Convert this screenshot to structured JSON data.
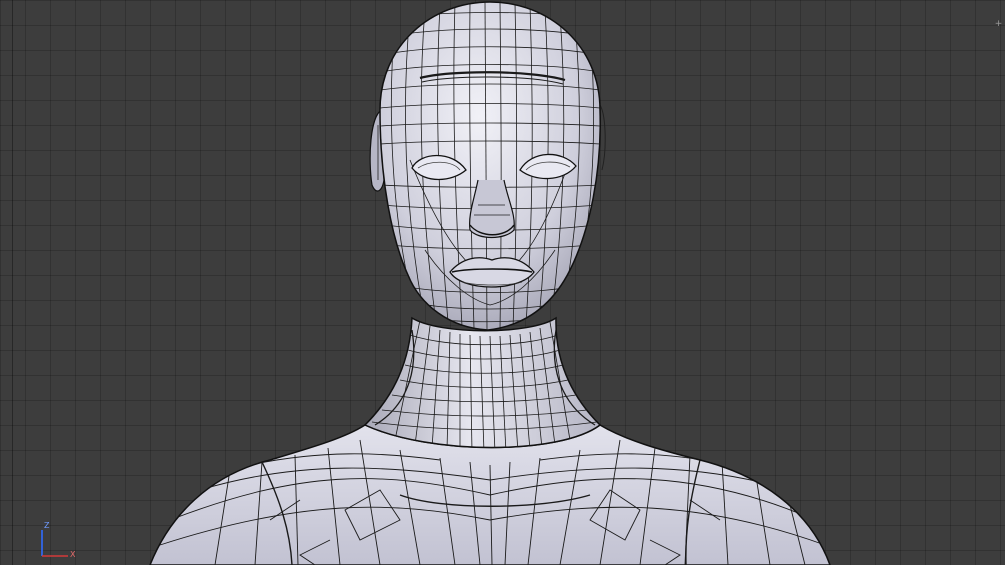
{
  "viewport": {
    "background_color": "#3d3d3d",
    "grid_color": "#333333",
    "mesh_color": "#c9c9d4",
    "wire_color": "#1a1a1a",
    "corner_handle_icon": "plus-icon",
    "corner_handle_glyph": "+"
  },
  "axis_gizmo": {
    "z_label": "Z",
    "x_label": "X",
    "z_color": "#2f6cff",
    "x_color": "#d43a3a"
  }
}
